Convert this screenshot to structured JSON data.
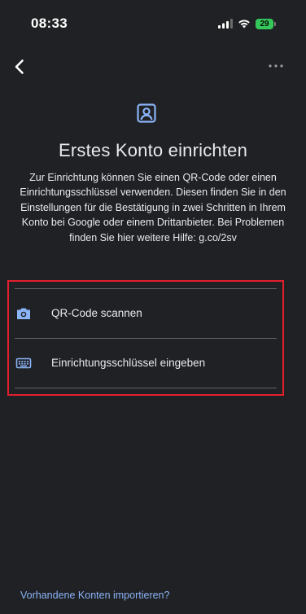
{
  "status_bar": {
    "time": "08:33",
    "battery": "29",
    "signal_icon": "cellular-signal-icon",
    "wifi_icon": "wifi-icon",
    "battery_color": "#34c759"
  },
  "nav": {
    "back_icon": "chevron-left-icon",
    "more_icon": "more-horizontal-icon"
  },
  "header": {
    "icon": "account-box-icon",
    "title": "Erstes Konto einrichten",
    "description": "Zur Einrichtung können Sie einen QR-Code oder einen Einrichtungsschlüssel verwenden. Diesen finden Sie in den Einstellungen für die Bestätigung in zwei Schritten in Ihrem Konto bei Google oder einem Drittanbieter. Bei Problemen finden Sie hier weitere Hilfe: g.co/2sv"
  },
  "options": [
    {
      "label": "QR-Code scannen",
      "icon": "camera-icon"
    },
    {
      "label": "Einrichtungsschlüssel eingeben",
      "icon": "keyboard-icon"
    }
  ],
  "footer": {
    "import_link": "Vorhandene Konten importieren?"
  },
  "colors": {
    "background": "#202124",
    "text": "#e8eaed",
    "accent": "#8ab4f8",
    "highlight_border": "#e2202c",
    "divider": "#5f6368"
  }
}
